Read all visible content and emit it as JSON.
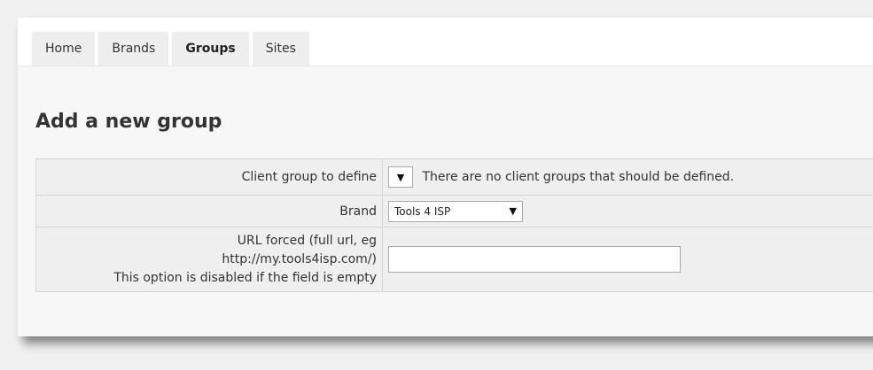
{
  "tabs": [
    {
      "label": "Home",
      "active": false
    },
    {
      "label": "Brands",
      "active": false
    },
    {
      "label": "Groups",
      "active": true
    },
    {
      "label": "Sites",
      "active": false
    }
  ],
  "page": {
    "title": "Add a new group"
  },
  "form": {
    "client_group": {
      "label": "Client group to define",
      "selected": "",
      "note": "There are no client groups that should be defined."
    },
    "brand": {
      "label": "Brand",
      "selected": "Tools 4 ISP"
    },
    "url_forced": {
      "label_line1": "URL forced (full url, eg",
      "label_line2": "http://my.tools4isp.com/)",
      "label_line3": "This option is disabled if the field is empty",
      "value": ""
    }
  },
  "icons": {
    "dropdown_arrow": "chevron-down-icon"
  }
}
